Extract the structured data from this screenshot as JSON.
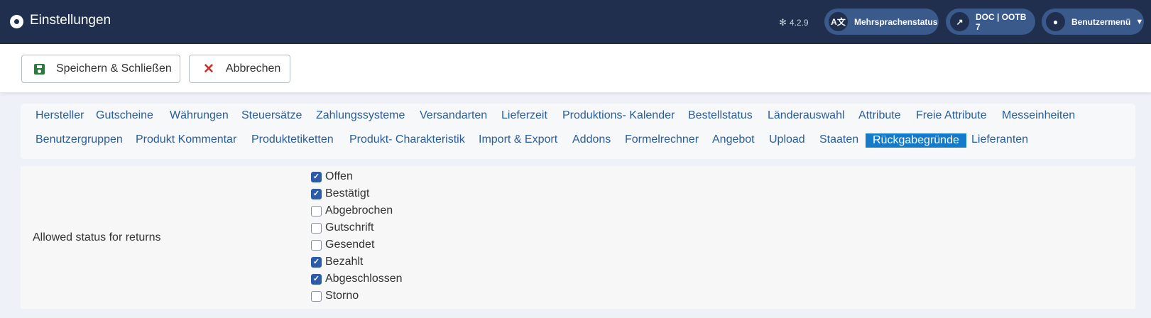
{
  "header": {
    "title": "Einstellungen",
    "version": "4.2.9",
    "multilang_label": "Mehrsprachenstatus",
    "doc_label": "DOC | OOTB 7",
    "user_menu_label": "Benutzermenü",
    "colors": {
      "bar": "#1f2f4d",
      "pill": "#3a5a8c"
    }
  },
  "toolbar": {
    "save_label": "Speichern & Schließen",
    "cancel_label": "Abbrechen"
  },
  "tabs": [
    "Hersteller",
    "Gutscheine",
    "Währungen",
    "Steuersätze",
    "Zahlungssysteme",
    "Versandarten",
    "Lieferzeit",
    "Produktions- Kalender",
    "Bestellstatus",
    "Länderauswahl",
    "Attribute",
    "Freie Attribute",
    "Messeinheiten",
    "Benutzergruppen",
    "Produkt Kommentar",
    "Produktetiketten",
    "Produkt- Charakteristik",
    "Import & Export",
    "Addons",
    "Formelrechner",
    "Angebot",
    "Upload",
    "Staaten",
    "Rückgabegründe",
    "Lieferanten"
  ],
  "active_tab": "Rückgabegründe",
  "form": {
    "field_label": "Allowed status for returns",
    "statuses": [
      {
        "label": "Offen",
        "checked": true
      },
      {
        "label": "Bestätigt",
        "checked": true
      },
      {
        "label": "Abgebrochen",
        "checked": false
      },
      {
        "label": "Gutschrift",
        "checked": false
      },
      {
        "label": "Gesendet",
        "checked": false
      },
      {
        "label": "Bezahlt",
        "checked": true
      },
      {
        "label": "Abgeschlossen",
        "checked": true
      },
      {
        "label": "Storno",
        "checked": false
      }
    ]
  },
  "colors": {
    "accent": "#137bc9",
    "checkbox": "#2e5aa8",
    "link": "#2a5d99"
  }
}
